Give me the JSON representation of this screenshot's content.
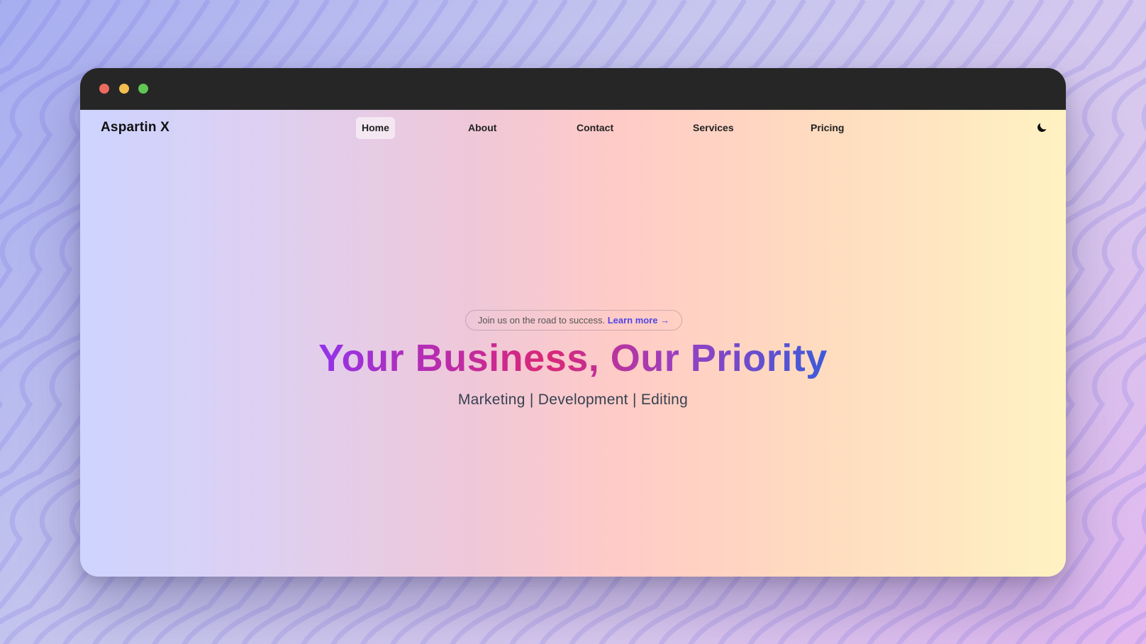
{
  "colors": {
    "titlebar": "#262626",
    "traffic_close": "#ec6a5e",
    "traffic_minimize": "#f4bf4f",
    "traffic_maximize": "#61c554",
    "link_accent": "#4f46e5",
    "headline_gradient": [
      "#9333ea",
      "#db2777",
      "#3b5bdb"
    ]
  },
  "navbar": {
    "brand": "Aspartin X",
    "items": [
      {
        "label": "Home",
        "active": true
      },
      {
        "label": "About",
        "active": false
      },
      {
        "label": "Contact",
        "active": false
      },
      {
        "label": "Services",
        "active": false
      },
      {
        "label": "Pricing",
        "active": false
      }
    ],
    "theme_toggle_icon": "moon-icon"
  },
  "hero": {
    "announcement_text": "Join us on the road to success.",
    "announcement_link": "Learn more →",
    "headline": "Your Business, Our Priority",
    "tagline": "Marketing | Development | Editing"
  }
}
